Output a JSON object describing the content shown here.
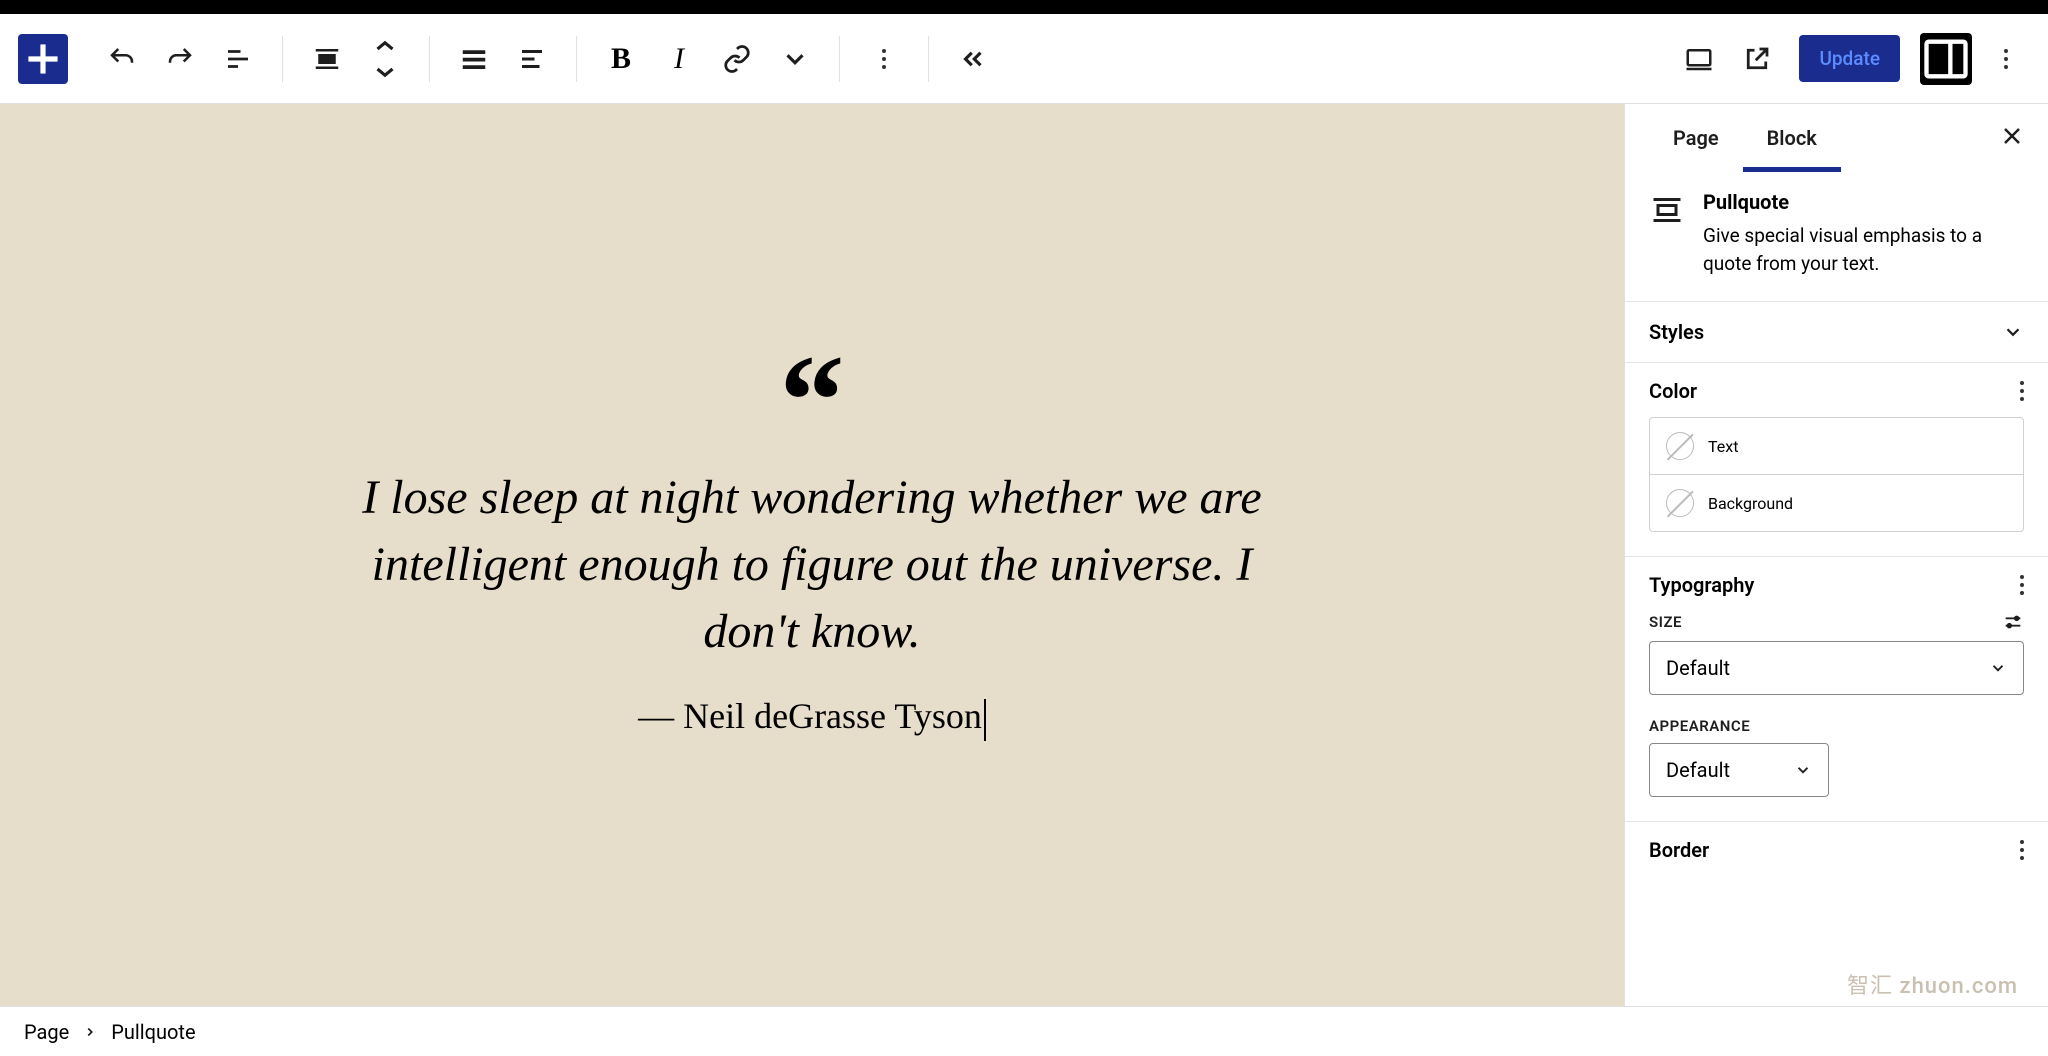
{
  "toolbar": {
    "update_label": "Update"
  },
  "canvas": {
    "quote_text": "I lose sleep at night wondering whether we are intelligent enough to figure out the universe. I don't know.",
    "quote_cite": "Neil deGrasse Tyson"
  },
  "sidebar": {
    "tabs": {
      "page": "Page",
      "block": "Block"
    },
    "block": {
      "name": "Pullquote",
      "description": "Give special visual emphasis to a quote from your text."
    },
    "panels": {
      "styles": "Styles",
      "color": {
        "title": "Color",
        "text": "Text",
        "background": "Background"
      },
      "typography": {
        "title": "Typography",
        "size_label": "SIZE",
        "size_value": "Default",
        "appearance_label": "APPEARANCE",
        "appearance_value": "Default"
      },
      "border": {
        "title": "Border"
      }
    }
  },
  "breadcrumb": {
    "root": "Page",
    "current": "Pullquote"
  },
  "watermark": "智汇 zhuon.com"
}
